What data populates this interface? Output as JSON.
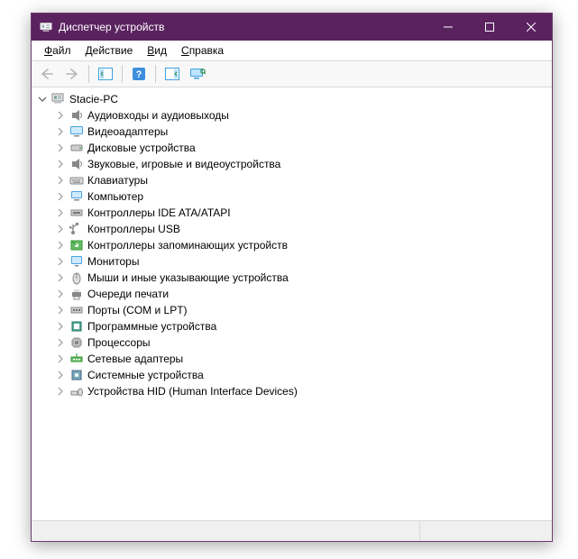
{
  "window": {
    "title": "Диспетчер устройств"
  },
  "menu": {
    "file": {
      "letter": "Ф",
      "rest": "айл"
    },
    "action": {
      "letter": "Д",
      "rest": "ействие"
    },
    "view": {
      "letter": "В",
      "rest": "ид"
    },
    "help": {
      "letter": "С",
      "rest": "правка"
    }
  },
  "root": {
    "label": "Stacie-PC"
  },
  "categories": [
    {
      "label": "Аудиовходы и аудиовыходы",
      "icon": "audio"
    },
    {
      "label": "Видеоадаптеры",
      "icon": "display"
    },
    {
      "label": "Дисковые устройства",
      "icon": "disk"
    },
    {
      "label": "Звуковые, игровые и видеоустройства",
      "icon": "audio"
    },
    {
      "label": "Клавиатуры",
      "icon": "keyboard"
    },
    {
      "label": "Компьютер",
      "icon": "computer"
    },
    {
      "label": "Контроллеры IDE ATA/ATAPI",
      "icon": "ide"
    },
    {
      "label": "Контроллеры USB",
      "icon": "usb"
    },
    {
      "label": "Контроллеры запоминающих устройств",
      "icon": "storage"
    },
    {
      "label": "Мониторы",
      "icon": "monitor"
    },
    {
      "label": "Мыши и иные указывающие устройства",
      "icon": "mouse"
    },
    {
      "label": "Очереди печати",
      "icon": "printer"
    },
    {
      "label": "Порты (COM и LPT)",
      "icon": "port"
    },
    {
      "label": "Программные устройства",
      "icon": "software"
    },
    {
      "label": "Процессоры",
      "icon": "cpu"
    },
    {
      "label": "Сетевые адаптеры",
      "icon": "network"
    },
    {
      "label": "Системные устройства",
      "icon": "system"
    },
    {
      "label": "Устройства HID (Human Interface Devices)",
      "icon": "hid"
    }
  ]
}
